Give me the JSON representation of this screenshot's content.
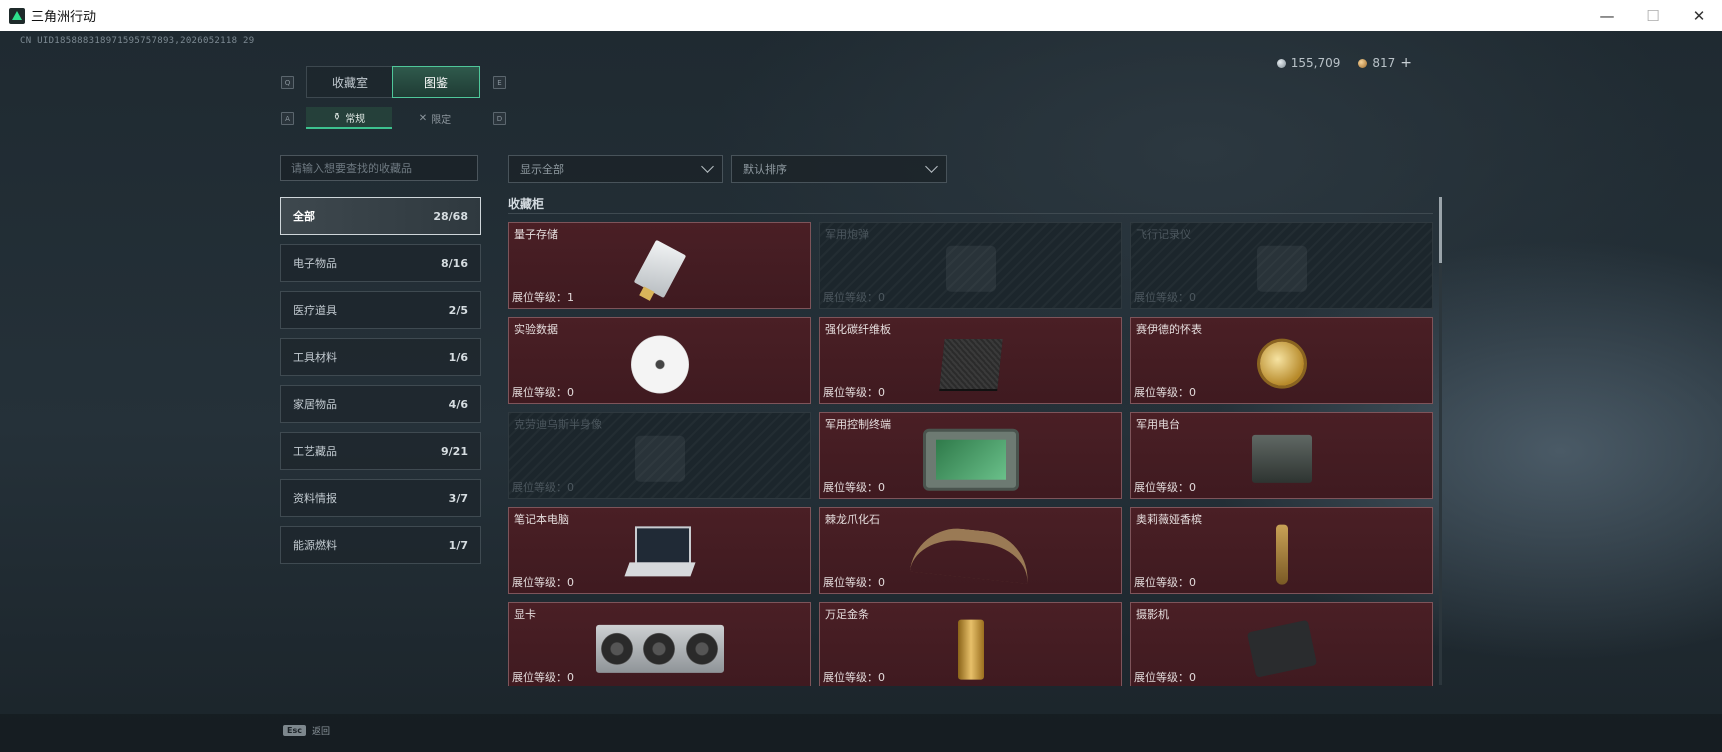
{
  "window": {
    "title": "三角洲行动",
    "minimize": "—",
    "maximize": "☐",
    "close": "✕"
  },
  "header": {
    "uid": "CN UID18588831897159575789З,2026052118 29",
    "silver_amount": "155,709",
    "gold_amount": "817",
    "plus": "+"
  },
  "tabs": {
    "left_key": "Q",
    "right_key": "E",
    "items": [
      {
        "label": "收藏室"
      },
      {
        "label": "图鉴"
      }
    ]
  },
  "subtabs": {
    "left_key": "A",
    "right_key": "D",
    "items": [
      {
        "label": "常规",
        "icon": "⚱"
      },
      {
        "label": "限定",
        "icon": "✕"
      }
    ]
  },
  "search": {
    "placeholder": "请输入想要查找的收藏品"
  },
  "categories": [
    {
      "label": "全部",
      "count": "28/68"
    },
    {
      "label": "电子物品",
      "count": "8/16"
    },
    {
      "label": "医疗道具",
      "count": "2/5"
    },
    {
      "label": "工具材料",
      "count": "1/6"
    },
    {
      "label": "家居物品",
      "count": "4/6"
    },
    {
      "label": "工艺藏品",
      "count": "9/21"
    },
    {
      "label": "资料情报",
      "count": "3/7"
    },
    {
      "label": "能源燃料",
      "count": "1/7"
    }
  ],
  "filters": {
    "show": "显示全部",
    "sort": "默认排序"
  },
  "section_title": "收藏柜",
  "level_label": "展位等级：",
  "items": [
    {
      "name": "量子存储",
      "level": "1",
      "locked": false,
      "art": "art-usb"
    },
    {
      "name": "军用炮弹",
      "level": "0",
      "locked": true,
      "art": "art-ghost"
    },
    {
      "name": "飞行记录仪",
      "level": "0",
      "locked": true,
      "art": "art-ghost"
    },
    {
      "name": "实验数据",
      "level": "0",
      "locked": false,
      "art": "art-disc"
    },
    {
      "name": "强化碳纤维板",
      "level": "0",
      "locked": false,
      "art": "art-plate"
    },
    {
      "name": "赛伊德的怀表",
      "level": "0",
      "locked": false,
      "art": "art-watch"
    },
    {
      "name": "克劳迪乌斯半身像",
      "level": "0",
      "locked": true,
      "art": "art-ghost"
    },
    {
      "name": "军用控制终端",
      "level": "0",
      "locked": false,
      "art": "art-term"
    },
    {
      "name": "军用电台",
      "level": "0",
      "locked": false,
      "art": "art-radio"
    },
    {
      "name": "笔记本电脑",
      "level": "0",
      "locked": false,
      "art": "art-laptop"
    },
    {
      "name": "棘龙爪化石",
      "level": "0",
      "locked": false,
      "art": "art-claw"
    },
    {
      "name": "奥莉薇娅香槟",
      "level": "0",
      "locked": false,
      "art": "art-bottle"
    },
    {
      "name": "显卡",
      "level": "0",
      "locked": false,
      "art": "art-gpu"
    },
    {
      "name": "万足金条",
      "level": "0",
      "locked": false,
      "art": "art-gold"
    },
    {
      "name": "摄影机",
      "level": "0",
      "locked": false,
      "art": "art-cam"
    }
  ],
  "footer": {
    "esc_key": "Esc",
    "esc_label": "返回"
  },
  "colors": {
    "accent": "#3dc28f",
    "card_owned": "#4a1f25",
    "card_locked": "#1c262c"
  }
}
